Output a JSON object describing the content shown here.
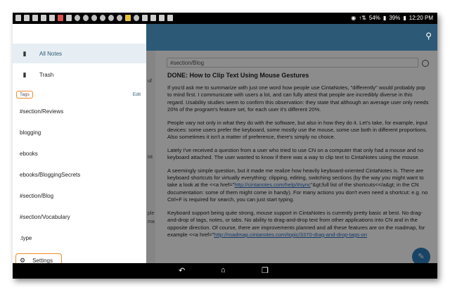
{
  "status_bar": {
    "signal": "↑⇅",
    "battery_primary": "54%",
    "battery_secondary": "39%",
    "time": "12:20 PM"
  },
  "app_bar": {
    "search_icon": "search-icon"
  },
  "drawer": {
    "items": [
      {
        "label": "All Notes",
        "icon": "notes-icon"
      },
      {
        "label": "Trash",
        "icon": "trash-icon"
      }
    ],
    "tags_label": "Tags",
    "edit_label": "Edit",
    "tags": [
      "#section/Reviews",
      "blogging",
      "ebooks",
      "ebooks/BloggingSecrets",
      "#section/Blog",
      "#section/Vocabulary",
      ".type"
    ],
    "settings_label": "Settings"
  },
  "list_fragments": [
    "",
    "uf",
    "",
    "ist",
    "",
    "ple",
    "ma"
  ],
  "note": {
    "tag": "#section/Blog",
    "title": "DONE: How to Clip Text Using Mouse Gestures",
    "p1": "If you'd ask me to summarize with just one word how people use CintaNotes, \"differently\" would probably pop to mind first. I communicate with users a lot, and can fully attest that people are incredibly diverse in this regard. Usability studies seem to confirm this observation: they state that although an average user only needs 20% of the program's feature set, for each user it's different 20%.",
    "p2": "People vary not only in what they do with the software, but also in how they do it. Let's take, for example, input devices: some users prefer the keyboard, some mostly use the mouse, some use both in different proportions. Also sometimes it isn't a matter of preference, there's simply no choice.",
    "p3": "Lately I've received a question from a user who tried to use CN on a computer that only had a mouse and no keyboard attached. The user wanted to know if there was a way to clip text to CintaNotes using the mouse.",
    "p4_a": "A seemingly simple question, but it made me realize how heavily keyboard-oriented CintaNotes is. There are keyboard shortcuts for virtually everything: clipping, editing, switching sections (by the way you might want to take a look at the <<a href=\"",
    "p4_link1": "http://cintanotes.com/help/#sync",
    "p4_b": "\"&gt;full list of the shortcuts<</a&gt; in the CN documentation: some of them might come in handy). For many actions you don't even need a shortcut: e.g. no Ctrl+F is required for search,  you can just start typing.",
    "p5_a": "Keyboard support being quite strong, mouse support in CintaNotes is currently pretty basic at best. No drag-and-drop of tags, notes, or tabs. No ability to drag-and-drop text from other applications into CN and in the opposite direction. Of course, there are improvements planned and all these features are on the roadmap, for example <<a href=\"",
    "p5_link": "http://roadmap.cintanotes.com/topic/3370-drag-and-drop-tags-on"
  },
  "fab_icon": "pencil-icon",
  "nav_bar": {
    "back": "↶",
    "home": "⌂",
    "recents": "❐"
  }
}
